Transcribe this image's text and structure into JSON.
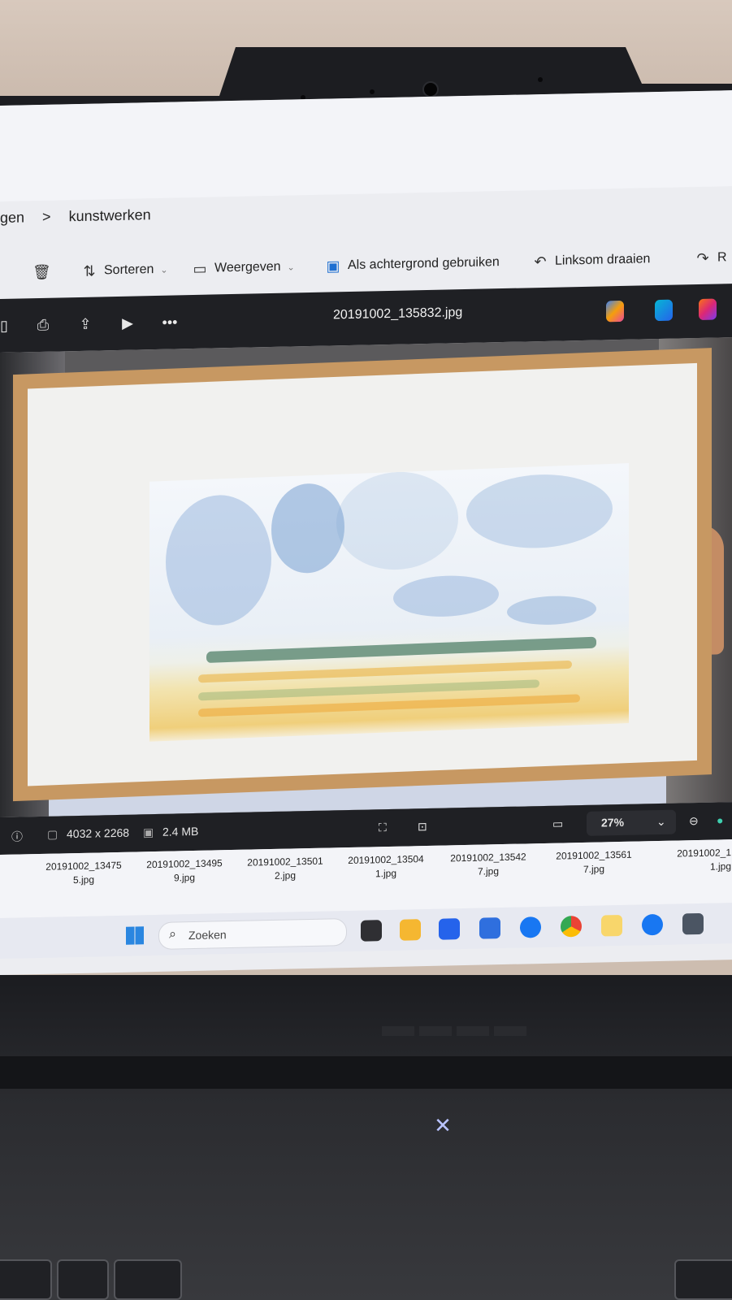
{
  "explorer": {
    "breadcrumb_prev": "gen",
    "breadcrumb_sep": ">",
    "breadcrumb_current": "kunstwerken",
    "commands": {
      "sort": "Sorteren",
      "view": "Weergeven",
      "wallpaper": "Als achtergrond gebruiken",
      "rotate_left": "Linksom draaien",
      "rotate_right_partial": "R"
    }
  },
  "viewer": {
    "file_title": "20191002_135832.jpg",
    "dimensions": "4032 x 2268",
    "file_size": "2.4 MB",
    "zoom": "27%"
  },
  "thumbnails": [
    {
      "line1": "20191002_13475",
      "line2": "5.jpg"
    },
    {
      "line1": "20191002_13495",
      "line2": "9.jpg"
    },
    {
      "line1": "20191002_13501",
      "line2": "2.jpg"
    },
    {
      "line1": "20191002_13504",
      "line2": "1.jpg"
    },
    {
      "line1": "20191002_13542",
      "line2": "7.jpg"
    },
    {
      "line1": "20191002_13561",
      "line2": "7.jpg"
    },
    {
      "line1": "20191002_1",
      "line2": "1.jpg"
    }
  ],
  "taskbar": {
    "search_placeholder": "Zoeken"
  },
  "colors": {
    "viewer_bar": "#1f2024",
    "taskbar": "#e7e9f1",
    "frame_wood": "#c79862",
    "accent_blue": "#2a86e0"
  }
}
